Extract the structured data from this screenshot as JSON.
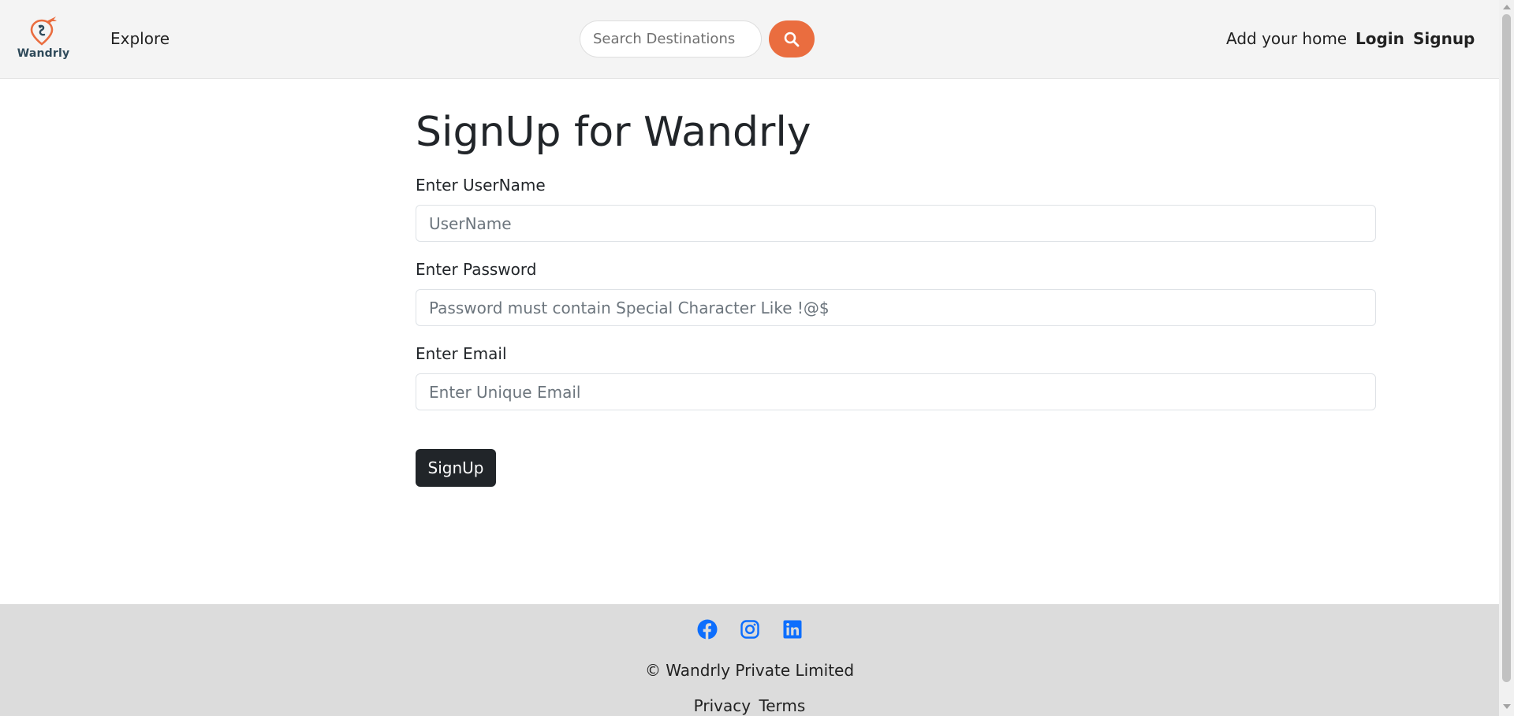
{
  "brand": {
    "name": "Wandrly",
    "accent_color": "#ea6d3f",
    "dark_color": "#2f4a5a"
  },
  "nav": {
    "explore": "Explore",
    "search_placeholder": "Search Destinations",
    "search_icon": "search-icon",
    "add_home": "Add your home",
    "login": "Login",
    "signup": "Signup"
  },
  "form": {
    "title": "SignUp for Wandrly",
    "username_label": "Enter UserName",
    "username_placeholder": "UserName",
    "password_label": "Enter Password",
    "password_placeholder": "Password must contain Special Character Like !@$",
    "email_label": "Enter Email",
    "email_placeholder": "Enter Unique Email",
    "submit_label": "SignUp"
  },
  "footer": {
    "social_icons": [
      "facebook-icon",
      "instagram-icon",
      "linkedin-icon"
    ],
    "social_color": "#0d6efd",
    "copyright": "© Wandrly Private Limited",
    "privacy": "Privacy",
    "terms": "Terms"
  }
}
